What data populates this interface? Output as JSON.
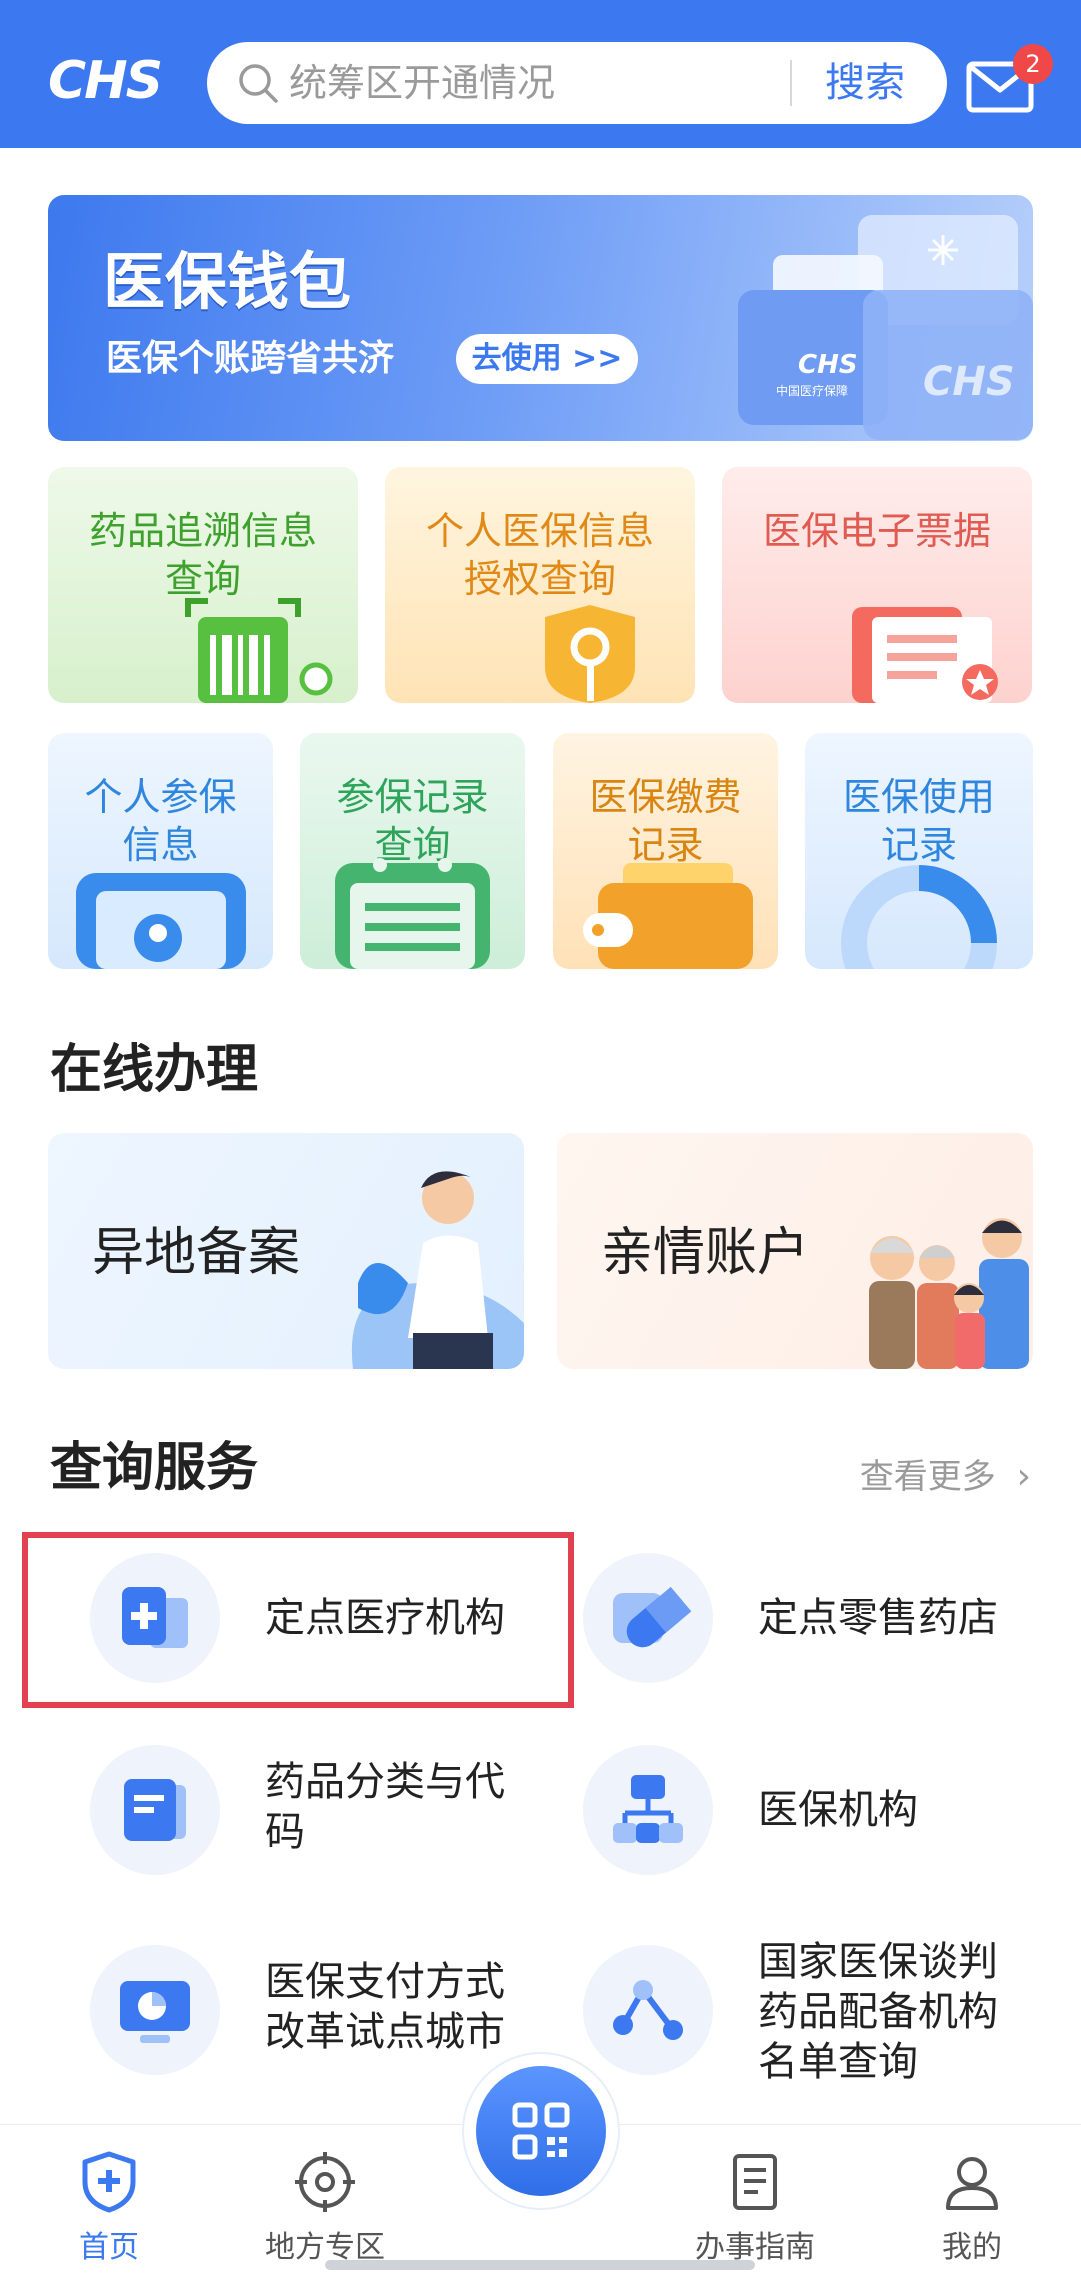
{
  "header": {
    "logo": "CHS",
    "search_placeholder": "统筹区开通情况",
    "search_button": "搜索",
    "mail_badge": "2"
  },
  "banner": {
    "title": "医保钱包",
    "subtitle": "医保个账跨省共济",
    "button": "去使用 >>",
    "art_text": "CHS",
    "art_caption": "中国医疗保障"
  },
  "grid_row1": [
    {
      "line1": "药品追溯信息",
      "line2": "查询"
    },
    {
      "line1": "个人医保信息",
      "line2": "授权查询"
    },
    {
      "line1": "医保电子票据",
      "line2": ""
    }
  ],
  "grid_row2": [
    {
      "line1": "个人参保",
      "line2": "信息"
    },
    {
      "line1": "参保记录",
      "line2": "查询"
    },
    {
      "line1": "医保缴费",
      "line2": "记录"
    },
    {
      "line1": "医保使用",
      "line2": "记录"
    }
  ],
  "online": {
    "title": "在线办理",
    "items": [
      "异地备案",
      "亲情账户"
    ]
  },
  "query": {
    "title": "查询服务",
    "more": "查看更多",
    "items": [
      {
        "line1": "定点医疗机构",
        "line2": ""
      },
      {
        "line1": "定点零售药店",
        "line2": ""
      },
      {
        "line1": "药品分类与代",
        "line2": "码"
      },
      {
        "line1": "医保机构",
        "line2": ""
      },
      {
        "line1": "医保支付方式",
        "line2": "改革试点城市"
      },
      {
        "line1": "国家医保谈判",
        "line2": "药品配备机构",
        "line3": "名单查询"
      }
    ]
  },
  "bottom_nav": [
    {
      "label": "首页",
      "icon": "shield-plus-icon",
      "active": true
    },
    {
      "label": "地方专区",
      "icon": "target-icon"
    },
    {
      "label": "",
      "icon": "qr-scan-icon"
    },
    {
      "label": "办事指南",
      "icon": "document-icon"
    },
    {
      "label": "我的",
      "icon": "user-icon"
    }
  ],
  "colors": {
    "primary": "#3c78f0",
    "highlight": "#e2414f"
  }
}
